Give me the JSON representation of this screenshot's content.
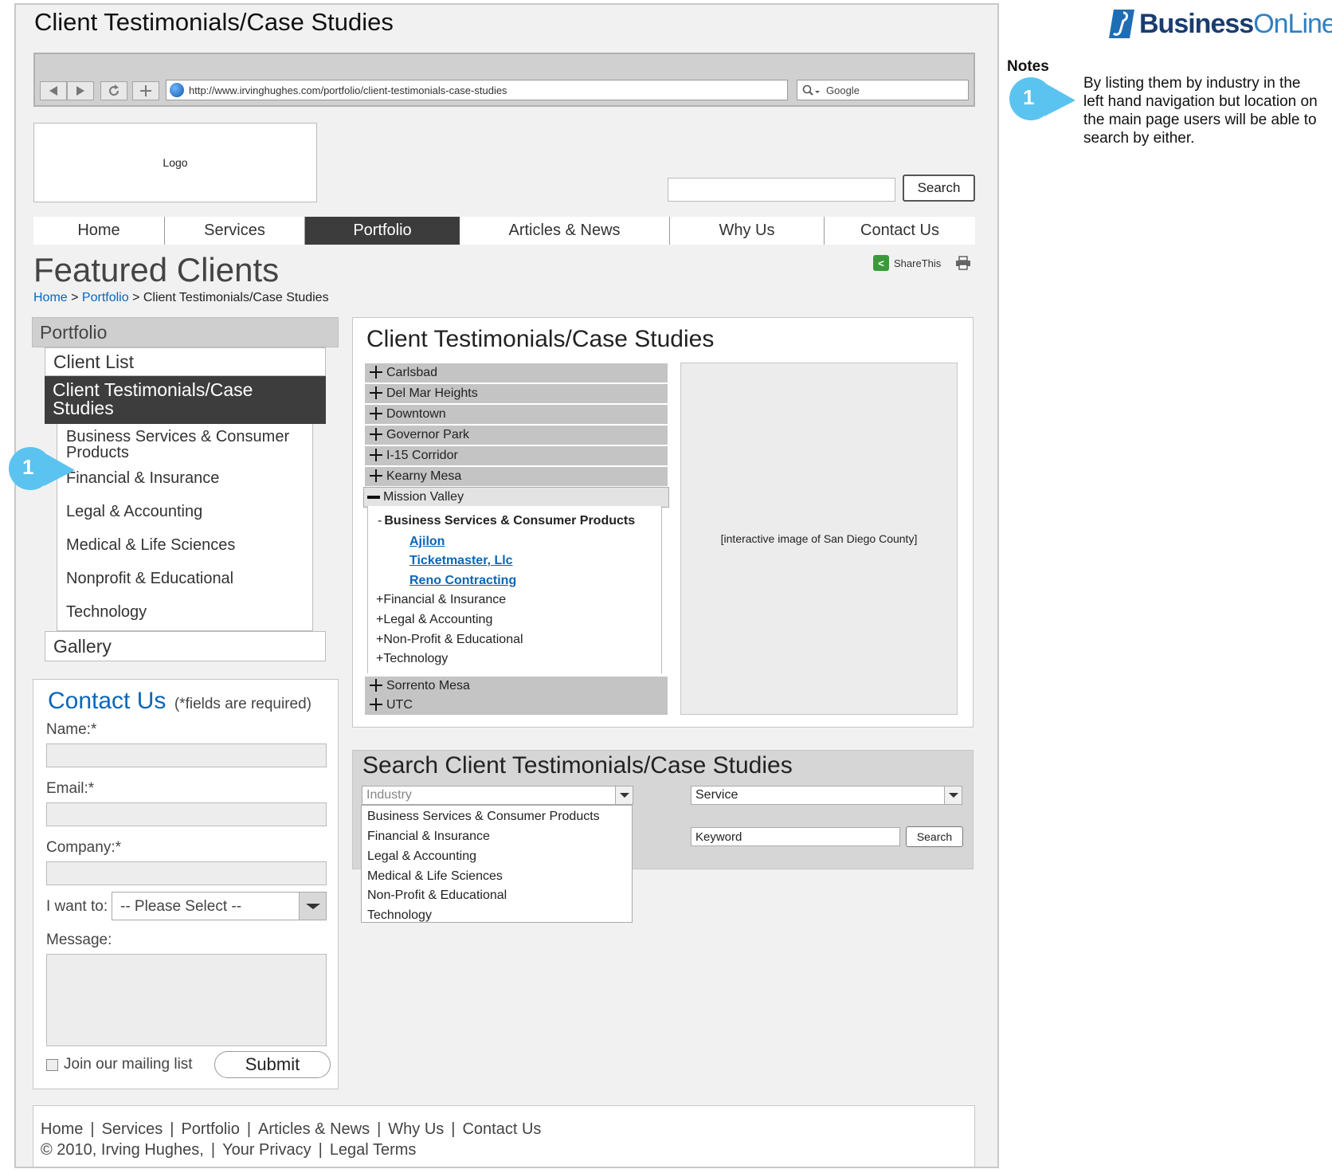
{
  "page": {
    "title": "Client Testimonials/Case Studies"
  },
  "browser": {
    "url": "http://www.irvinghughes.com/portfolio/client-testimonials-case-studies",
    "search_placeholder": "Google"
  },
  "header": {
    "logo_label": "Logo",
    "search_button": "Search"
  },
  "nav": {
    "items": [
      "Home",
      "Services",
      "Portfolio",
      "Articles & News",
      "Why Us",
      "Contact Us"
    ],
    "active": "Portfolio"
  },
  "featured": {
    "heading": "Featured Clients",
    "share_label": "ShareThis"
  },
  "breadcrumb": {
    "home": "Home",
    "sep1": " > ",
    "portfolio": "Portfolio",
    "sep2": " > ",
    "current": "Client Testimonials/Case Studies"
  },
  "left_nav": {
    "heading": "Portfolio",
    "client_list": "Client List",
    "active": "Client Testimonials/Case Studies",
    "sub_items": [
      "Business Services & Consumer Products",
      "Financial & Insurance",
      "Legal & Accounting",
      "Medical & Life Sciences",
      "Nonprofit & Educational",
      "Technology"
    ],
    "gallery": "Gallery"
  },
  "callout": {
    "number": "1"
  },
  "contact": {
    "heading": "Contact Us",
    "required_note": "(*fields are required)",
    "name_label": "Name:*",
    "email_label": "Email:*",
    "company_label": "Company:*",
    "want_label": "I want to:",
    "want_value": "-- Please Select --",
    "message_label": "Message:",
    "mailing_label": "Join our mailing list",
    "submit_label": "Submit"
  },
  "content": {
    "heading": "Client Testimonials/Case Studies",
    "locations_top": [
      "Carlsbad",
      "Del Mar Heights",
      "Downtown",
      "Governor Park",
      "I-15 Corridor",
      "Kearny Mesa"
    ],
    "open_location": "Mission Valley",
    "tree": {
      "open_industry": "Business Services & Consumer Products",
      "clients": [
        "Ajilon",
        "Ticketmaster, Llc",
        "Reno Contracting"
      ],
      "collapsed_industries": [
        "Financial & Insurance",
        "Legal & Accounting",
        "Non-Profit & Educational",
        "Technology"
      ]
    },
    "locations_bottom": [
      "Sorrento Mesa",
      "UTC"
    ],
    "map_placeholder": "[interactive image of San Diego County]"
  },
  "search_section": {
    "heading": "Search Client Testimonials/Case Studies",
    "industry_placeholder": "Industry",
    "industry_options": [
      "Business Services & Consumer Products",
      "Financial & Insurance",
      "Legal & Accounting",
      "Medical & Life Sciences",
      "Non-Profit & Educational",
      "Technology"
    ],
    "service_value": "Service",
    "keyword_value": "Keyword",
    "search_button": "Search"
  },
  "footer": {
    "links": [
      "Home",
      "Services",
      "Portfolio",
      "Articles & News",
      "Why Us",
      "Contact Us"
    ],
    "copyright": "© 2010, Irving Hughes,",
    "privacy": "Your Privacy",
    "terms": "Legal Terms"
  },
  "brand": {
    "part1": "Business",
    "part2": "OnLine"
  },
  "notes": {
    "title": "Notes",
    "number": "1",
    "text": "By listing them by industry in the left hand navigation but location on the main page users will be able to search by either."
  },
  "colors": {
    "link": "#0a66b8",
    "nav_active": "#3c3c3c",
    "callout": "#5bc3ef",
    "accordion": "#c4c4c4"
  }
}
